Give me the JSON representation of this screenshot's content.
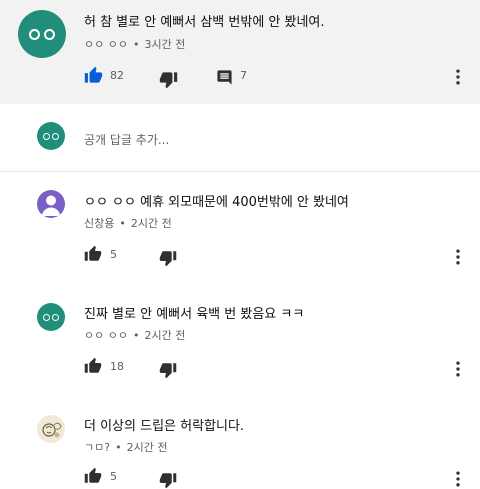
{
  "main_comment": {
    "text": "허 참 별로 안 예뻐서 삼백 번밖에 안 봤네여.",
    "author": "ㅇㅇ ㅇㅇ",
    "time": "3시간 전",
    "likes": "82",
    "replies": "7"
  },
  "reply_box": {
    "placeholder": "공개 답글 추가..."
  },
  "replies": [
    {
      "text": "ㅇㅇ ㅇㅇ 예휴 외모때문에 400번밖에 안 봤네여",
      "author": "신창용",
      "time": "2시간 전",
      "likes": "5"
    },
    {
      "text": "진짜 별로 안 예뻐서 육백 번 봤음요 ㅋㅋ",
      "author": "ㅇㅇ ㅇㅇ",
      "time": "2시간 전",
      "likes": "18"
    },
    {
      "text": "더 이상의 드립은 허락합니다.",
      "author": "ㄱㅁ?",
      "time": "2시간 전",
      "likes": "5"
    }
  ],
  "separator": "•",
  "colors": {
    "teal_avatar": "#208e7a",
    "purple_avatar": "#7b5fc4",
    "like_active": "#065fd4",
    "icon_dark": "#303030"
  }
}
